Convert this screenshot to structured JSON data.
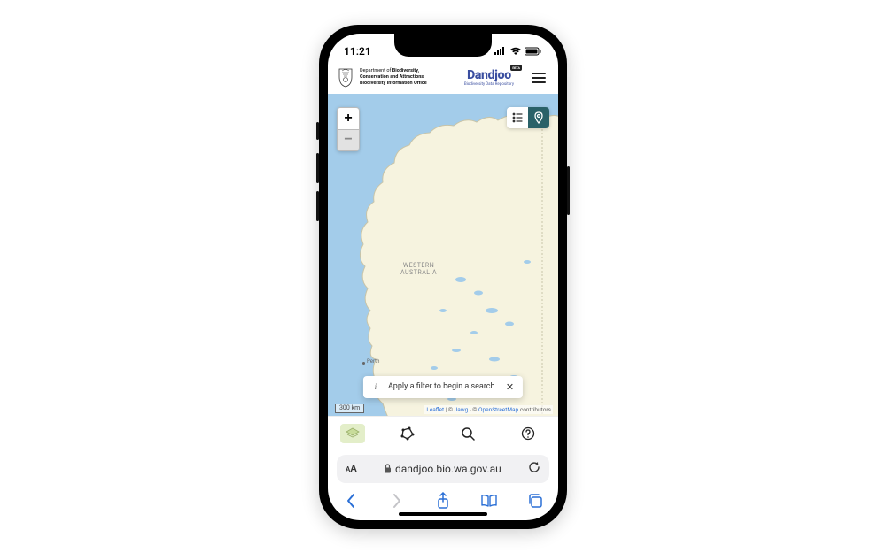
{
  "status": {
    "time": "11:21"
  },
  "header": {
    "dept_line1_prefix": "Department of ",
    "dept_line1_bold": "Biodiversity,",
    "dept_line2": "Conservation and Attractions",
    "dept_line3": "Biodiversity Information Office",
    "brand_name": "Dandjoo",
    "brand_beta": "BETA",
    "brand_sub": "Biodiversity Data Repository"
  },
  "map": {
    "zoom_in": "+",
    "zoom_out": "−",
    "region_label_l1": "WESTERN",
    "region_label_l2": "AUSTRALIA",
    "city_label": "Perth",
    "scale": "300 km",
    "attr_leaflet": "Leaflet",
    "attr_sep1": " | © ",
    "attr_jawg": "Jawg",
    "attr_sep2": " - © ",
    "attr_osm": "OpenStreetMap",
    "attr_tail": " contributors",
    "toast_info": "i",
    "toast_msg": "Apply a filter to begin a search.",
    "toast_close": "✕"
  },
  "url": {
    "aa": "AA",
    "domain": "dandjoo.bio.wa.gov.au"
  }
}
